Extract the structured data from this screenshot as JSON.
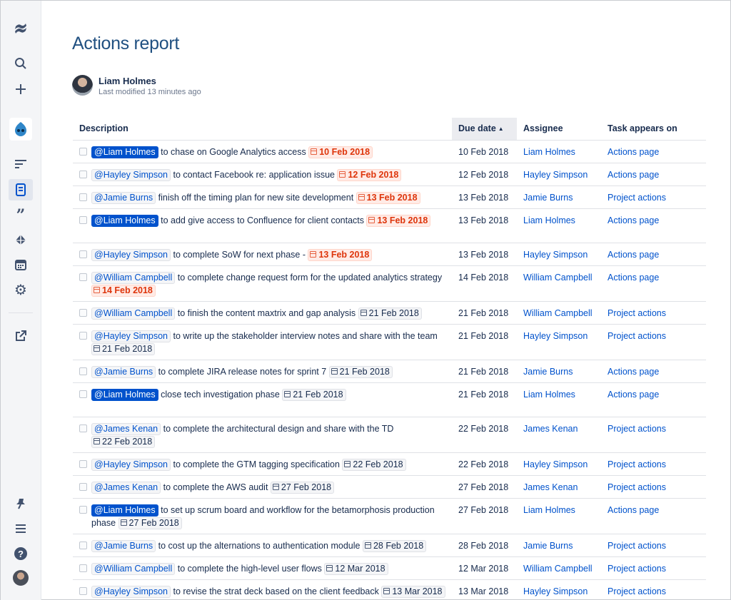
{
  "sidebar": {
    "logo_icon": "confluence-logo-icon",
    "icons": [
      "search-icon",
      "plus-icon",
      "space-avatar",
      "lines-icon",
      "pages-icon",
      "quote-icon",
      "feather-icon",
      "calendar-icon",
      "gear-icon",
      "external-link-icon",
      "pin-icon",
      "menu-icon",
      "help-icon",
      "user-avatar"
    ]
  },
  "page": {
    "title": "Actions report",
    "author": "Liam Holmes",
    "modified": "Last modified 13 minutes ago"
  },
  "table": {
    "headers": {
      "description": "Description",
      "due_date": "Due date",
      "assignee": "Assignee",
      "task_appears_on": "Task appears on"
    },
    "sort_indicator": "▲",
    "rows": [
      {
        "mention": "@Liam Holmes",
        "me": true,
        "text": " to chase on Google Analytics access ",
        "date": "10 Feb 2018",
        "overdue": true,
        "due": "10 Feb 2018",
        "assignee": "Liam Holmes",
        "page": "Actions page"
      },
      {
        "mention": "@Hayley Simpson",
        "me": false,
        "text": " to contact Facebook re: application issue ",
        "date": "12 Feb 2018",
        "overdue": true,
        "due": "12 Feb 2018",
        "assignee": "Hayley Simpson",
        "page": "Actions page"
      },
      {
        "mention": "@Jamie Burns",
        "me": false,
        "text": " finish off the timing plan for new site development ",
        "date": "13 Feb 2018",
        "overdue": true,
        "due": "13 Feb 2018",
        "assignee": "Jamie Burns",
        "page": "Project actions"
      },
      {
        "mention": "@Liam Holmes",
        "me": true,
        "text": " to add give access to Confluence for client contacts ",
        "date": "13 Feb 2018",
        "overdue": true,
        "due": "13 Feb 2018",
        "assignee": "Liam Holmes",
        "page": "Actions page"
      },
      {
        "mention": "@Hayley Simpson",
        "me": false,
        "text": " to complete SoW for next phase - ",
        "date": "13 Feb 2018",
        "overdue": true,
        "due": "13 Feb 2018",
        "assignee": "Hayley Simpson",
        "page": "Actions page"
      },
      {
        "mention": "@William Campbell",
        "me": false,
        "text": " to complete change request form for the updated analytics strategy ",
        "date": "14 Feb 2018",
        "overdue": true,
        "due": "14 Feb 2018",
        "assignee": "William Campbell",
        "page": "Actions page"
      },
      {
        "mention": "@William Campbell",
        "me": false,
        "text": " to finish the content maxtrix and gap analysis ",
        "date": "21 Feb 2018",
        "overdue": false,
        "due": "21 Feb 2018",
        "assignee": "William Campbell",
        "page": "Project actions"
      },
      {
        "mention": "@Hayley Simpson",
        "me": false,
        "text": " to write up the stakeholder interview notes and share with the team ",
        "date": "21 Feb 2018",
        "overdue": false,
        "due": "21 Feb 2018",
        "assignee": "Hayley Simpson",
        "page": "Project actions"
      },
      {
        "mention": "@Jamie Burns",
        "me": false,
        "text": " to complete JIRA release notes for sprint 7 ",
        "date": "21 Feb 2018",
        "overdue": false,
        "due": "21 Feb 2018",
        "assignee": "Jamie Burns",
        "page": "Actions page"
      },
      {
        "mention": "@Liam Holmes",
        "me": true,
        "text": " close tech investigation phase ",
        "date": "21 Feb 2018",
        "overdue": false,
        "due": "21 Feb 2018",
        "assignee": "Liam Holmes",
        "page": "Actions page"
      },
      {
        "mention": "@James Kenan",
        "me": false,
        "text": " to complete the architectural design and share with the TD ",
        "date": "22 Feb 2018",
        "overdue": false,
        "due": "22 Feb 2018",
        "assignee": "James Kenan",
        "page": "Project actions"
      },
      {
        "mention": "@Hayley Simpson",
        "me": false,
        "text": " to complete the GTM tagging specification ",
        "date": "22 Feb 2018",
        "overdue": false,
        "due": "22 Feb 2018",
        "assignee": "Hayley Simpson",
        "page": "Project actions"
      },
      {
        "mention": "@James Kenan",
        "me": false,
        "text": " to complete the AWS audit ",
        "date": "27 Feb 2018",
        "overdue": false,
        "due": "27 Feb 2018",
        "assignee": "James Kenan",
        "page": "Project actions"
      },
      {
        "mention": "@Liam Holmes",
        "me": true,
        "text": " to set up scrum board and workflow for the betamorphosis production phase ",
        "date": "27 Feb 2018",
        "overdue": false,
        "due": "27 Feb 2018",
        "assignee": "Liam Holmes",
        "page": "Actions page"
      },
      {
        "mention": "@Jamie Burns",
        "me": false,
        "text": " to cost up the alternations to authentication module ",
        "date": "28 Feb 2018",
        "overdue": false,
        "due": "28 Feb 2018",
        "assignee": "Jamie Burns",
        "page": "Project actions"
      },
      {
        "mention": "@William Campbell",
        "me": false,
        "text": " to complete the high-level user flows ",
        "date": "12 Mar 2018",
        "overdue": false,
        "due": "12 Mar 2018",
        "assignee": "William Campbell",
        "page": "Project actions"
      },
      {
        "mention": "@Hayley Simpson",
        "me": false,
        "text": " to revise the strat deck based on the client feedback ",
        "date": "13 Mar 2018",
        "overdue": false,
        "due": "13 Mar 2018",
        "assignee": "Hayley Simpson",
        "page": "Project actions"
      }
    ]
  },
  "colors": {
    "title": "#205081",
    "link": "#0052cc",
    "overdue": "#de350b",
    "mention_self_bg": "#0052cc"
  }
}
